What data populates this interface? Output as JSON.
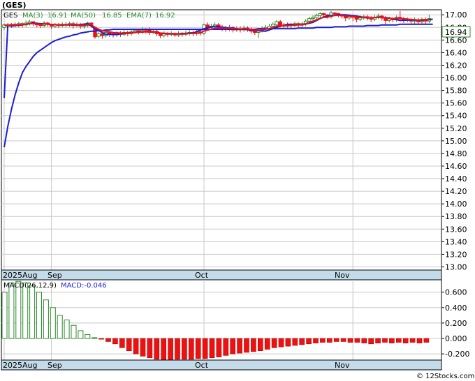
{
  "title": "(GES)",
  "watermark": "© 12Stocks.com",
  "legend": {
    "ticker": "GES",
    "ma3": "MA(3)",
    "ma3_value": "16.91",
    "ma50": "MA(50)",
    "ma50_value": "16.85",
    "ema7": "EMA(7)",
    "ema7_value": "16.92"
  },
  "last_price_label": "16.94",
  "macd_legend": {
    "name": "MACD(26,12,9)",
    "value": "MACD:-0.046"
  },
  "colors": {
    "up": "#2e8b2e",
    "down": "#ee1111",
    "ma50": "#1c1cd6",
    "ma3": "#1c1cd6",
    "ema7": "#ee1111",
    "grid": "#c8c8c8",
    "date_axis": "#c4dcea",
    "ma_line": "#1c1cd6"
  },
  "chart_data": [
    {
      "type": "candlestick",
      "title": "(GES)",
      "ylim": [
        12.95,
        17.08
      ],
      "y_ticks": [
        "13.00",
        "13.20",
        "13.40",
        "13.60",
        "13.80",
        "14.00",
        "14.20",
        "14.40",
        "14.60",
        "14.80",
        "15.00",
        "15.20",
        "15.40",
        "15.60",
        "15.80",
        "16.00",
        "16.20",
        "16.40",
        "16.60",
        "16.80",
        "17.00"
      ],
      "x_labels": [
        "2025Aug",
        "Sep",
        "Oct",
        "Nov"
      ],
      "x_label_index": [
        0,
        13,
        55,
        96
      ],
      "grid": true,
      "candles": [
        [
          16.8,
          16.84,
          16.76,
          16.86
        ],
        [
          16.84,
          16.82,
          16.79,
          16.87
        ],
        [
          16.82,
          16.85,
          16.79,
          16.87
        ],
        [
          16.85,
          16.83,
          16.8,
          16.88
        ],
        [
          16.83,
          16.86,
          16.8,
          16.89
        ],
        [
          16.86,
          16.84,
          16.8,
          16.88
        ],
        [
          16.84,
          16.87,
          16.81,
          16.91
        ],
        [
          16.87,
          16.89,
          16.83,
          16.92
        ],
        [
          16.89,
          16.86,
          16.82,
          16.9
        ],
        [
          16.86,
          16.84,
          16.8,
          16.88
        ],
        [
          16.84,
          16.83,
          16.79,
          16.87
        ],
        [
          16.83,
          16.87,
          16.8,
          16.9
        ],
        [
          16.87,
          16.85,
          16.81,
          16.89
        ],
        [
          16.85,
          16.82,
          16.78,
          16.86
        ],
        [
          16.82,
          16.84,
          16.79,
          16.87
        ],
        [
          16.84,
          16.83,
          16.79,
          16.87
        ],
        [
          16.83,
          16.85,
          16.8,
          16.88
        ],
        [
          16.85,
          16.84,
          16.8,
          16.88
        ],
        [
          16.84,
          16.86,
          16.81,
          16.89
        ],
        [
          16.86,
          16.83,
          16.78,
          16.89
        ],
        [
          16.83,
          16.85,
          16.8,
          16.88
        ],
        [
          16.85,
          16.82,
          16.78,
          16.87
        ],
        [
          16.82,
          16.83,
          16.78,
          16.86
        ],
        [
          16.83,
          16.87,
          16.8,
          16.89
        ],
        [
          16.87,
          16.85,
          16.8,
          16.88
        ],
        [
          16.8,
          16.65,
          16.62,
          16.82
        ],
        [
          16.66,
          16.7,
          16.63,
          16.73
        ],
        [
          16.7,
          16.67,
          16.62,
          16.72
        ],
        [
          16.67,
          16.72,
          16.64,
          16.75
        ],
        [
          16.72,
          16.7,
          16.65,
          16.74
        ],
        [
          16.7,
          16.68,
          16.64,
          16.73
        ],
        [
          16.68,
          16.71,
          16.65,
          16.74
        ],
        [
          16.71,
          16.69,
          16.65,
          16.74
        ],
        [
          16.69,
          16.72,
          16.66,
          16.76
        ],
        [
          16.72,
          16.7,
          16.66,
          16.75
        ],
        [
          16.7,
          16.73,
          16.67,
          16.78
        ],
        [
          16.73,
          16.75,
          16.7,
          16.78
        ],
        [
          16.75,
          16.72,
          16.69,
          16.78
        ],
        [
          16.72,
          16.75,
          16.7,
          16.8
        ],
        [
          16.75,
          16.74,
          16.7,
          16.79
        ],
        [
          16.76,
          16.72,
          16.68,
          16.8
        ],
        [
          16.72,
          16.74,
          16.69,
          16.77
        ],
        [
          16.74,
          16.7,
          16.66,
          16.76
        ],
        [
          16.7,
          16.67,
          16.63,
          16.72
        ],
        [
          16.67,
          16.7,
          16.64,
          16.74
        ],
        [
          16.7,
          16.69,
          16.65,
          16.73
        ],
        [
          16.69,
          16.7,
          16.66,
          16.74
        ],
        [
          16.7,
          16.68,
          16.65,
          16.72
        ],
        [
          16.68,
          16.7,
          16.65,
          16.74
        ],
        [
          16.7,
          16.69,
          16.65,
          16.73
        ],
        [
          16.69,
          16.71,
          16.66,
          16.75
        ],
        [
          16.71,
          16.72,
          16.67,
          16.76
        ],
        [
          16.72,
          16.7,
          16.66,
          16.75
        ],
        [
          16.7,
          16.73,
          16.67,
          16.77
        ],
        [
          16.73,
          16.71,
          16.67,
          16.76
        ],
        [
          16.71,
          16.84,
          16.68,
          16.86
        ],
        [
          16.84,
          16.8,
          16.76,
          16.88
        ],
        [
          16.8,
          16.82,
          16.77,
          16.86
        ],
        [
          16.82,
          16.84,
          16.78,
          16.88
        ],
        [
          16.84,
          16.8,
          16.76,
          16.87
        ],
        [
          16.8,
          16.78,
          16.74,
          16.84
        ],
        [
          16.78,
          16.77,
          16.73,
          16.82
        ],
        [
          16.77,
          16.8,
          16.74,
          16.84
        ],
        [
          16.8,
          16.76,
          16.72,
          16.82
        ],
        [
          16.76,
          16.78,
          16.73,
          16.82
        ],
        [
          16.78,
          16.76,
          16.72,
          16.82
        ],
        [
          16.76,
          16.79,
          16.73,
          16.83
        ],
        [
          16.79,
          16.77,
          16.73,
          16.82
        ],
        [
          16.77,
          16.74,
          16.7,
          16.8
        ],
        [
          16.74,
          16.72,
          16.68,
          16.77
        ],
        [
          16.72,
          16.75,
          16.63,
          16.78
        ],
        [
          16.75,
          16.78,
          16.72,
          16.82
        ],
        [
          16.78,
          16.8,
          16.74,
          16.84
        ],
        [
          16.78,
          16.82,
          16.75,
          16.86
        ],
        [
          16.82,
          16.85,
          16.78,
          16.88
        ],
        [
          16.84,
          16.89,
          16.8,
          16.92
        ],
        [
          16.89,
          16.84,
          16.8,
          16.92
        ],
        [
          16.84,
          16.82,
          16.78,
          16.87
        ],
        [
          16.82,
          16.85,
          16.79,
          16.88
        ],
        [
          16.85,
          16.83,
          16.79,
          16.87
        ],
        [
          16.83,
          16.86,
          16.8,
          16.89
        ],
        [
          16.86,
          16.84,
          16.8,
          16.88
        ],
        [
          16.84,
          16.86,
          16.8,
          16.89
        ],
        [
          16.86,
          16.9,
          16.82,
          16.93
        ],
        [
          16.9,
          16.94,
          16.86,
          16.97
        ],
        [
          16.94,
          16.96,
          16.9,
          16.99
        ],
        [
          16.96,
          16.99,
          16.93,
          17.02
        ],
        [
          16.99,
          17.02,
          16.95,
          17.04
        ],
        [
          17.02,
          17.0,
          16.96,
          17.03
        ],
        [
          17.0,
          16.97,
          16.94,
          17.01
        ],
        [
          16.97,
          17.03,
          16.94,
          17.06
        ],
        [
          17.03,
          17.02,
          16.98,
          17.04
        ],
        [
          17.02,
          17.0,
          16.96,
          17.03
        ],
        [
          17.0,
          16.98,
          16.94,
          17.02
        ],
        [
          16.98,
          16.95,
          16.9,
          17.01
        ],
        [
          16.95,
          16.98,
          16.92,
          17.01
        ],
        [
          16.98,
          16.96,
          16.9,
          17.0
        ],
        [
          16.96,
          16.93,
          16.88,
          16.99
        ],
        [
          16.93,
          16.95,
          16.9,
          16.99
        ],
        [
          16.95,
          16.97,
          16.92,
          17.0
        ],
        [
          16.97,
          16.95,
          16.91,
          17.0
        ],
        [
          16.95,
          16.93,
          16.88,
          16.98
        ],
        [
          16.93,
          16.96,
          16.9,
          17.0
        ],
        [
          16.96,
          16.98,
          16.93,
          17.02
        ],
        [
          16.98,
          16.95,
          16.91,
          17.0
        ],
        [
          16.95,
          16.91,
          16.84,
          16.98
        ],
        [
          16.91,
          16.94,
          16.88,
          16.97
        ],
        [
          16.94,
          16.92,
          16.88,
          16.96
        ],
        [
          16.92,
          16.96,
          16.89,
          16.99
        ],
        [
          16.96,
          16.94,
          16.9,
          17.06
        ],
        [
          16.94,
          16.91,
          16.87,
          16.97
        ],
        [
          16.91,
          16.93,
          16.88,
          16.96
        ],
        [
          16.93,
          16.9,
          16.86,
          16.95
        ],
        [
          16.9,
          16.92,
          16.86,
          16.96
        ],
        [
          16.92,
          16.89,
          16.85,
          16.95
        ],
        [
          16.89,
          16.93,
          16.86,
          16.96
        ],
        [
          16.93,
          16.9,
          16.86,
          16.96
        ],
        [
          16.9,
          16.94,
          16.87,
          17.0
        ]
      ],
      "ma50": [
        14.9,
        15.23,
        15.5,
        15.73,
        15.92,
        16.08,
        16.18,
        16.26,
        16.34,
        16.4,
        16.44,
        16.48,
        16.52,
        16.56,
        16.59,
        16.61,
        16.63,
        16.65,
        16.66,
        16.68,
        16.69,
        16.71,
        16.72,
        16.73,
        16.74,
        16.74,
        16.75,
        16.75,
        16.76,
        16.76,
        16.77,
        16.77,
        16.77,
        16.77,
        16.77,
        16.77,
        16.77,
        16.77,
        16.77,
        16.77,
        16.77,
        16.77,
        16.77,
        16.77,
        16.77,
        16.77,
        16.77,
        16.77,
        16.77,
        16.77,
        16.77,
        16.77,
        16.77,
        16.77,
        16.77,
        16.77,
        16.77,
        16.77,
        16.77,
        16.77,
        16.77,
        16.77,
        16.77,
        16.77,
        16.77,
        16.77,
        16.77,
        16.77,
        16.77,
        16.77,
        16.78,
        16.78,
        16.78,
        16.78,
        16.78,
        16.78,
        16.78,
        16.78,
        16.78,
        16.78,
        16.78,
        16.79,
        16.79,
        16.79,
        16.79,
        16.79,
        16.8,
        16.8,
        16.8,
        16.8,
        16.8,
        16.81,
        16.81,
        16.81,
        16.81,
        16.82,
        16.82,
        16.82,
        16.82,
        16.82,
        16.83,
        16.83,
        16.83,
        16.83,
        16.84,
        16.84,
        16.84,
        16.84,
        16.84,
        16.85,
        16.85,
        16.85,
        16.85,
        16.85,
        16.85,
        16.85,
        16.85,
        16.85,
        16.85
      ],
      "ma3_pts": [
        [
          0,
          15.68
        ],
        [
          1,
          16.84
        ],
        [
          2,
          16.82
        ],
        [
          3,
          16.83
        ],
        [
          5,
          16.84
        ],
        [
          8,
          16.87
        ],
        [
          12,
          16.85
        ],
        [
          16,
          16.84
        ],
        [
          20,
          16.84
        ],
        [
          23,
          16.86
        ],
        [
          25,
          16.78
        ],
        [
          28,
          16.69
        ],
        [
          31,
          16.69
        ],
        [
          34,
          16.71
        ],
        [
          38,
          16.73
        ],
        [
          41,
          16.73
        ],
        [
          44,
          16.7
        ],
        [
          48,
          16.7
        ],
        [
          52,
          16.71
        ],
        [
          55,
          16.78
        ],
        [
          58,
          16.82
        ],
        [
          62,
          16.79
        ],
        [
          66,
          16.77
        ],
        [
          69,
          16.75
        ],
        [
          72,
          16.74
        ],
        [
          75,
          16.8
        ],
        [
          78,
          16.85
        ],
        [
          82,
          16.84
        ],
        [
          85,
          16.88
        ],
        [
          88,
          16.97
        ],
        [
          91,
          17.0
        ],
        [
          94,
          17.0
        ],
        [
          97,
          16.98
        ],
        [
          100,
          16.95
        ],
        [
          103,
          16.96
        ],
        [
          106,
          16.95
        ],
        [
          109,
          16.91
        ],
        [
          112,
          16.92
        ],
        [
          115,
          16.91
        ],
        [
          118,
          16.93
        ]
      ]
    },
    {
      "type": "bar",
      "title": "MACD(26,12,9)",
      "ylim": [
        -0.28,
        0.76
      ],
      "y_ticks": [
        "0.600",
        "0.400",
        "0.200",
        "0.000",
        "-0.200"
      ],
      "values": [
        0.6,
        0.72,
        0.74,
        0.72,
        0.68,
        0.6,
        0.5,
        0.4,
        0.3,
        0.24,
        0.17,
        0.1,
        0.05,
        0.01,
        -0.01,
        -0.04,
        -0.07,
        -0.12,
        -0.16,
        -0.2,
        -0.23,
        -0.25,
        -0.27,
        -0.28,
        -0.28,
        -0.27,
        -0.27,
        -0.27,
        -0.26,
        -0.26,
        -0.25,
        -0.24,
        -0.22,
        -0.2,
        -0.19,
        -0.18,
        -0.17,
        -0.16,
        -0.14,
        -0.12,
        -0.11,
        -0.1,
        -0.09,
        -0.08,
        -0.07,
        -0.06,
        -0.05,
        -0.05,
        -0.04,
        -0.04,
        -0.05,
        -0.05,
        -0.06,
        -0.07,
        -0.06,
        -0.05,
        -0.06,
        -0.05,
        -0.06,
        -0.05,
        -0.06,
        -0.05
      ],
      "x_labels": [
        "2025Aug",
        "Sep",
        "Oct",
        "Nov"
      ]
    }
  ]
}
